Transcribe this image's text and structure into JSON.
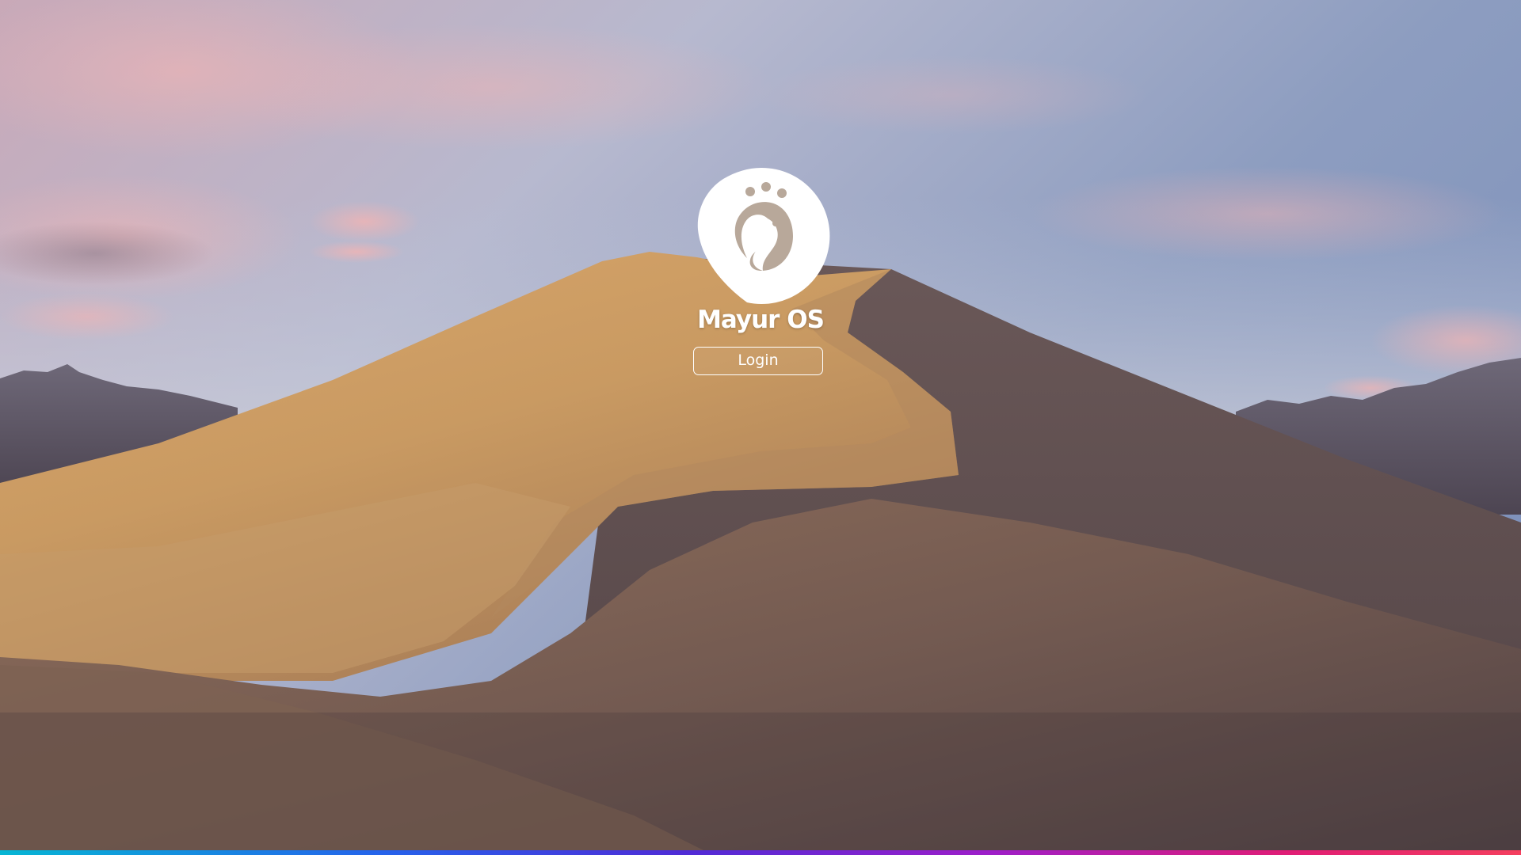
{
  "login_screen": {
    "logo": {
      "icon": "peacock-logo-icon"
    },
    "os_name": "Mayur OS",
    "login_button_label": "Login"
  },
  "wallpaper": {
    "description_icon": "desert-dunes-wallpaper"
  },
  "colors": {
    "text": "#ffffff",
    "bottom_bar_gradient": [
      "#06b6d4",
      "#2563eb",
      "#4f2bd6",
      "#9d1ec9",
      "#e11d74",
      "#f43f5e"
    ]
  }
}
